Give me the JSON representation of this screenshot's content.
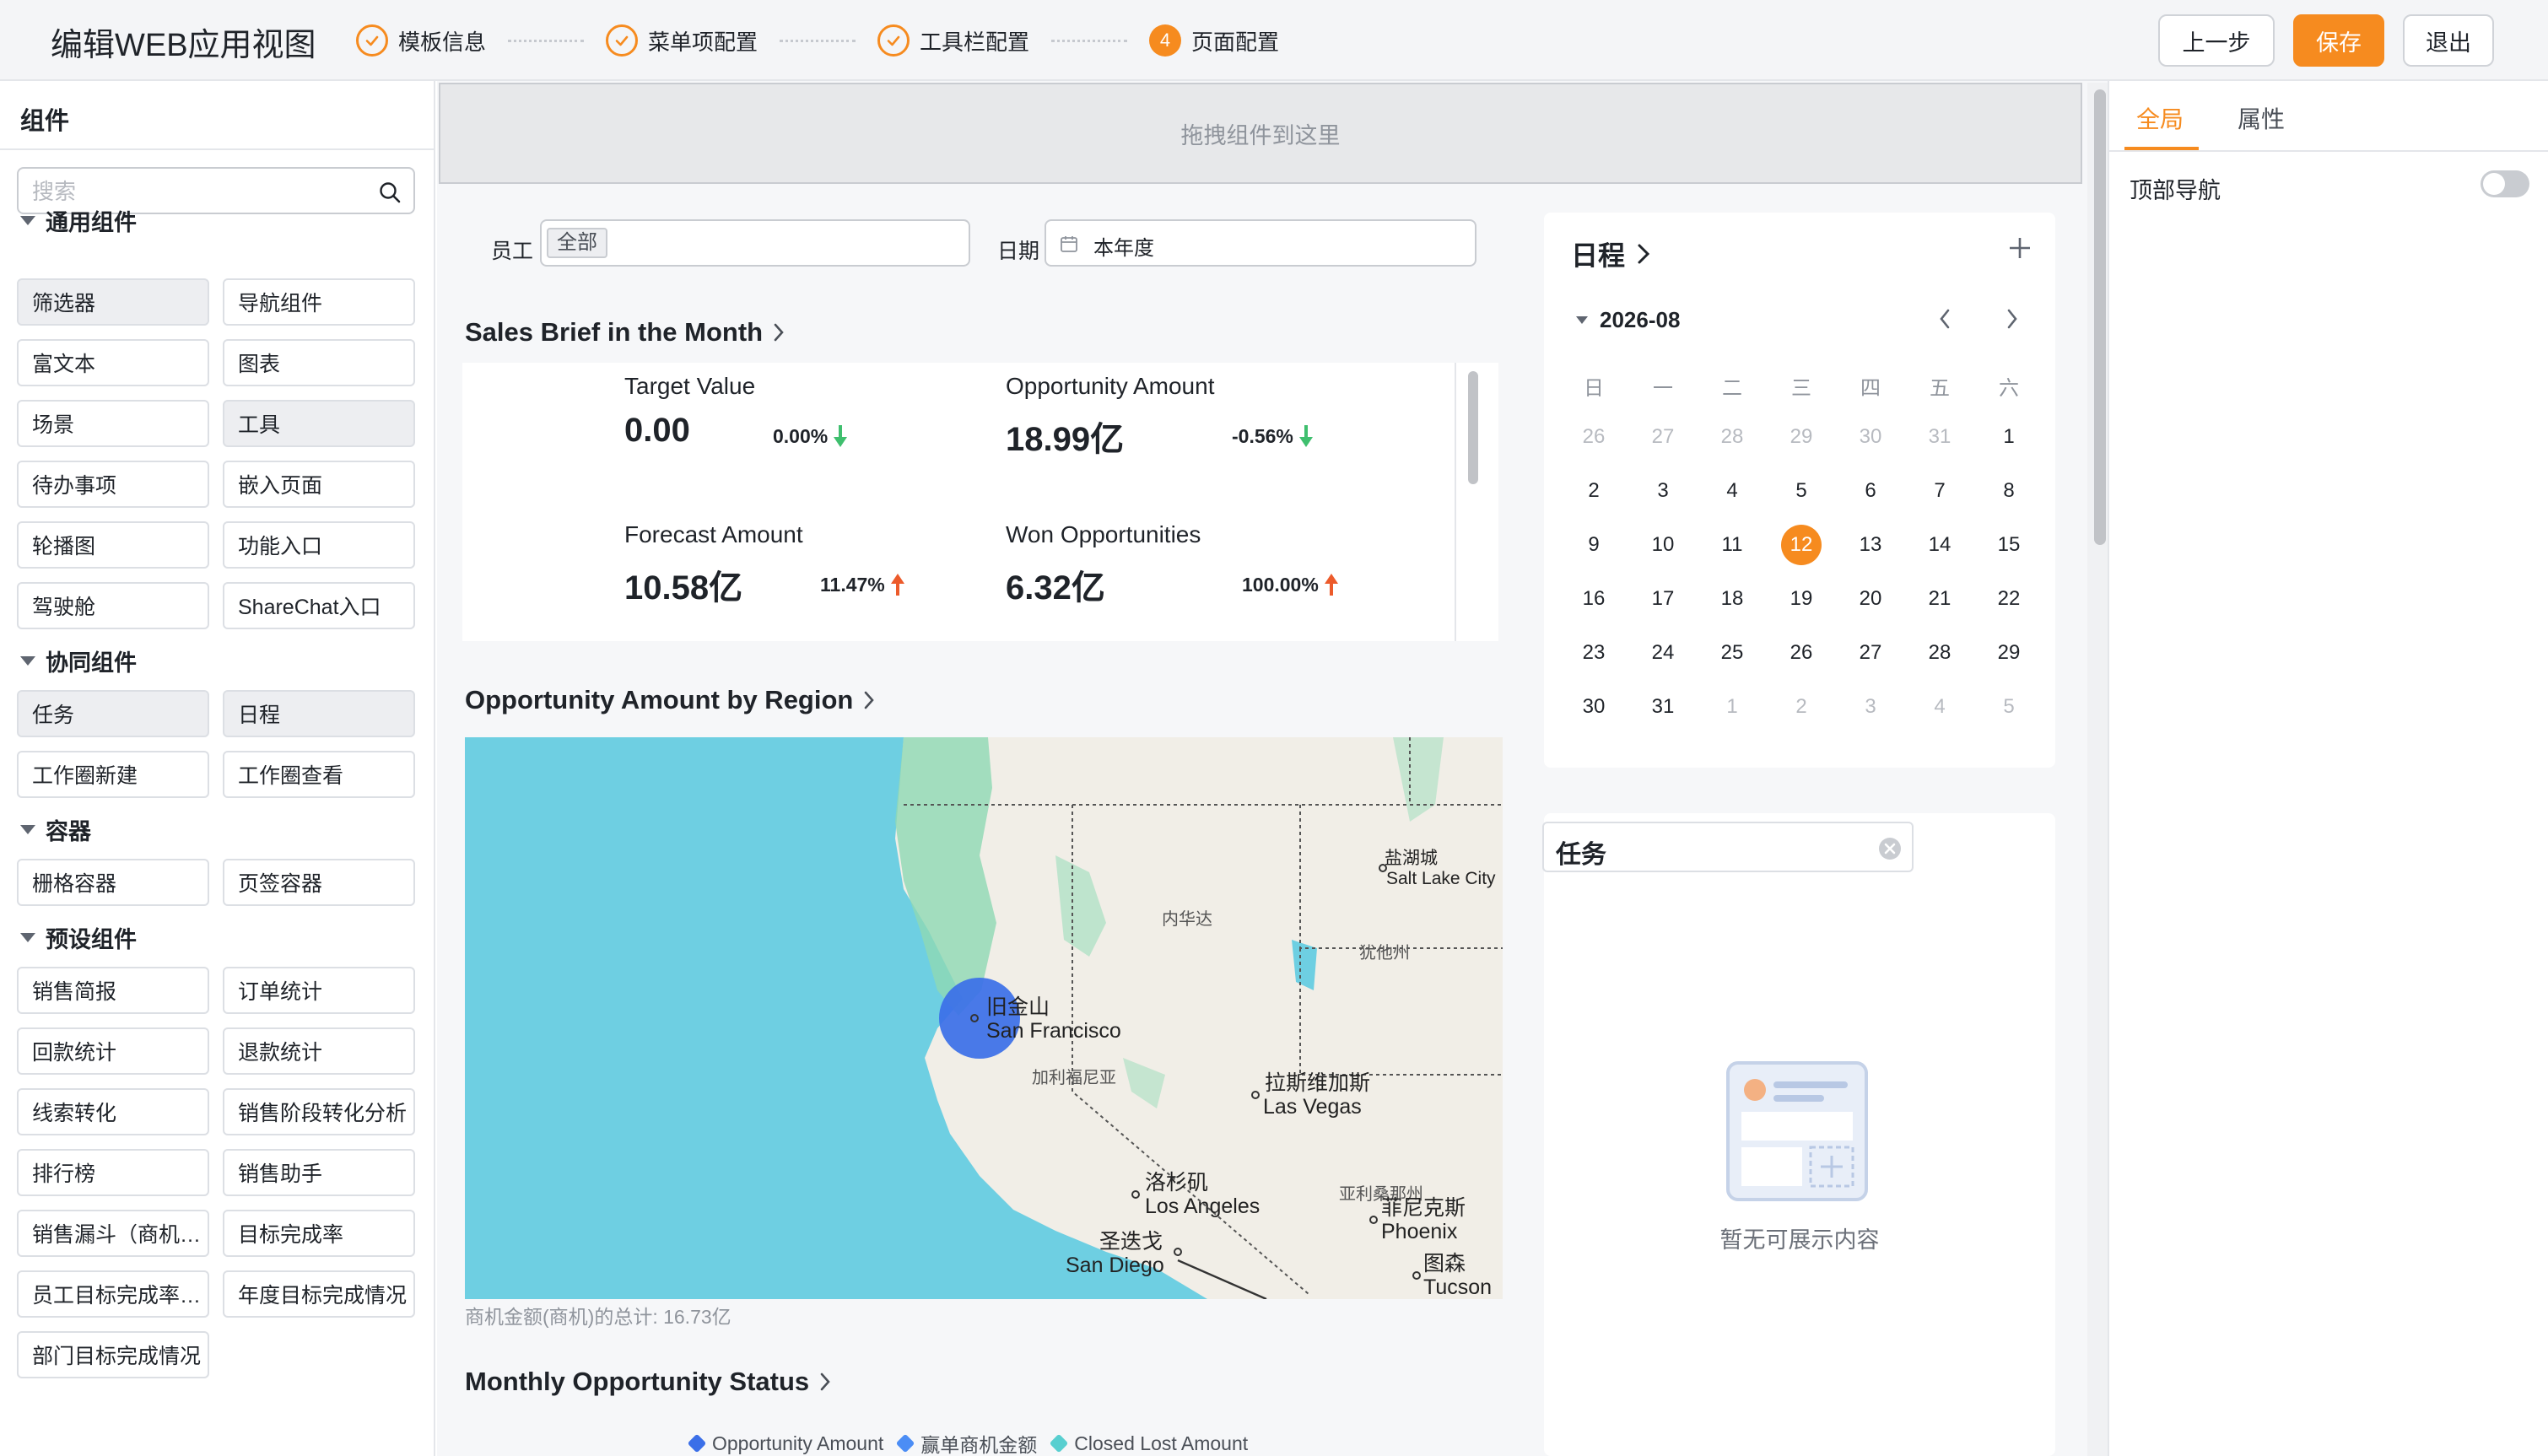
{
  "header": {
    "title": "编辑WEB应用视图",
    "steps": [
      {
        "label": "模板信息",
        "status": "done"
      },
      {
        "label": "菜单项配置",
        "status": "done"
      },
      {
        "label": "工具栏配置",
        "status": "done"
      },
      {
        "label": "页面配置",
        "status": "current",
        "number": "4"
      }
    ],
    "buttons": {
      "prev": "上一步",
      "save": "保存",
      "exit": "退出"
    }
  },
  "left_panel": {
    "title": "组件",
    "search_placeholder": "搜索",
    "groups": [
      {
        "label": "通用组件",
        "items": [
          "筛选器",
          "导航组件",
          "富文本",
          "图表",
          "场景",
          "工具",
          "待办事项",
          "嵌入页面",
          "轮播图",
          "功能入口",
          "驾驶舱",
          "ShareChat入口"
        ]
      },
      {
        "label": "协同组件",
        "items": [
          "任务",
          "日程",
          "工作圈新建",
          "工作圈查看"
        ]
      },
      {
        "label": "容器",
        "items": [
          "栅格容器",
          "页签容器"
        ]
      },
      {
        "label": "预设组件",
        "items": [
          "销售简报",
          "订单统计",
          "回款统计",
          "退款统计",
          "线索转化",
          "销售阶段转化分析",
          "排行榜",
          "销售助手",
          "销售漏斗（商机…",
          "目标完成率",
          "员工目标完成率…",
          "年度目标完成情况",
          "部门目标完成情况"
        ]
      }
    ]
  },
  "canvas": {
    "dropzone_text": "拖拽组件到这里",
    "filters": {
      "employee_label": "员工",
      "employee_tag": "全部",
      "date_label": "日期",
      "date_value": "本年度"
    },
    "sales_brief": {
      "title": "Sales Brief in the Month",
      "kpis": [
        {
          "label": "Target Value",
          "value": "0.00",
          "change": "0.00%",
          "direction": "down"
        },
        {
          "label": "Opportunity Amount",
          "value": "18.99亿",
          "change": "-0.56%",
          "direction": "down"
        },
        {
          "label": "Forecast Amount",
          "value": "10.58亿",
          "change": "11.47%",
          "direction": "up"
        },
        {
          "label": "Won Opportunities",
          "value": "6.32亿",
          "change": "100.00%",
          "direction": "up"
        }
      ]
    },
    "region_map": {
      "title": "Opportunity Amount by Region",
      "labels": {
        "salt_lake_cn": "盐湖城",
        "salt_lake_en": "Salt Lake City",
        "nevada": "内华达",
        "utah": "犹他州",
        "sf_cn": "旧金山",
        "sf_en": "San Francisco",
        "california": "加利福尼亚",
        "lv_cn": "拉斯维加斯",
        "lv_en": "Las Vegas",
        "arizona": "亚利桑那州",
        "la_cn": "洛杉矶",
        "la_en": "Los Angeles",
        "phx_cn": "菲尼克斯",
        "phx_en": "Phoenix",
        "sd_cn": "圣迭戈",
        "sd_en": "San Diego",
        "tucson_cn": "图森",
        "tucson_en": "Tucson"
      },
      "total_text": "商机金额(商机)的总计: 16.73亿"
    },
    "monthly_status": {
      "title": "Monthly Opportunity Status",
      "legend": [
        {
          "label": "Opportunity Amount",
          "color": "#3b6fe8"
        },
        {
          "label": "赢单商机金额",
          "color": "#4b8df5"
        },
        {
          "label": "Closed Lost Amount",
          "color": "#58cfd0"
        }
      ]
    },
    "calendar": {
      "title": "日程",
      "month": "2026-08",
      "weekdays": [
        "日",
        "一",
        "二",
        "三",
        "四",
        "五",
        "六"
      ],
      "days": [
        [
          "26",
          "27",
          "28",
          "29",
          "30",
          "31",
          "1"
        ],
        [
          "2",
          "3",
          "4",
          "5",
          "6",
          "7",
          "8"
        ],
        [
          "9",
          "10",
          "11",
          "12",
          "13",
          "14",
          "15"
        ],
        [
          "16",
          "17",
          "18",
          "19",
          "20",
          "21",
          "22"
        ],
        [
          "23",
          "24",
          "25",
          "26",
          "27",
          "28",
          "29"
        ],
        [
          "30",
          "31",
          "1",
          "2",
          "3",
          "4",
          "5"
        ]
      ],
      "today": "12"
    },
    "tasks": {
      "title": "任务",
      "empty_text": "暂无可展示内容"
    }
  },
  "right_panel": {
    "tabs": [
      "全局",
      "属性"
    ],
    "active_tab": "全局",
    "top_nav_label": "顶部导航",
    "top_nav_enabled": false
  },
  "colors": {
    "accent": "#f68b1f",
    "up": "#ec5b2b",
    "down": "#3fbf6e"
  }
}
